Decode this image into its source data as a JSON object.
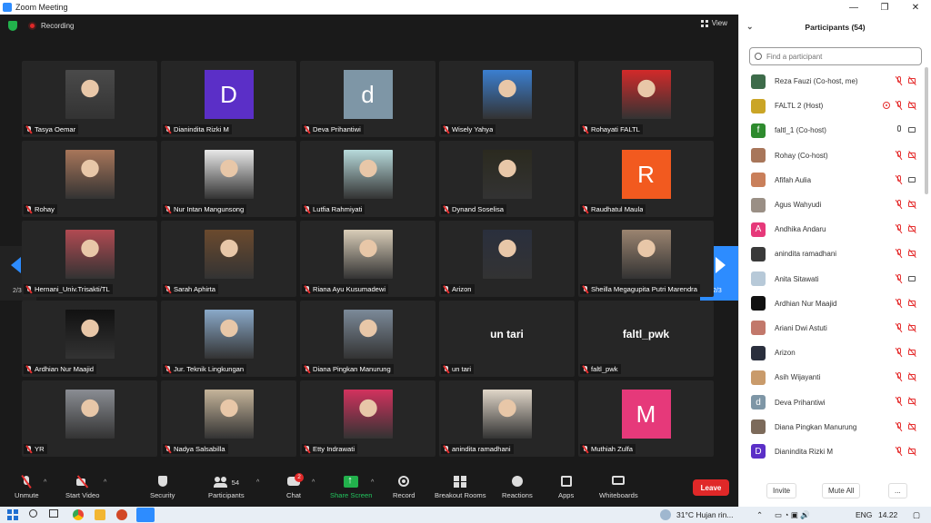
{
  "window": {
    "title": "Zoom Meeting",
    "minimize": "—",
    "maximize": "❐",
    "close": "✕"
  },
  "topbar": {
    "recording": "Recording",
    "view": "View"
  },
  "pager": {
    "left": "2/3",
    "right": "2/3"
  },
  "tiles": [
    {
      "name": "Tasya Oemar",
      "kind": "photo",
      "color": "#4a4a4a"
    },
    {
      "name": "Dianindita Rizki M",
      "kind": "letter",
      "letter": "D",
      "color": "#5b2fc7"
    },
    {
      "name": "Deva Prihantiwi",
      "kind": "letter",
      "letter": "d",
      "color": "#7e96a6"
    },
    {
      "name": "Wisely Yahya",
      "kind": "photo",
      "color": "#3b7fd0"
    },
    {
      "name": "Rohayati FALTL",
      "kind": "photo",
      "color": "#d22a2a"
    },
    {
      "name": "Rohay",
      "kind": "photo",
      "color": "#a8765a"
    },
    {
      "name": "Nur Intan Mangunsong",
      "kind": "photo",
      "color": "#e8e8e8"
    },
    {
      "name": "Lutfia Rahmiyati",
      "kind": "photo",
      "color": "#b7dadb"
    },
    {
      "name": "Dynand Soselisa",
      "kind": "photo",
      "color": "#2b2a1f"
    },
    {
      "name": "Raudhatul Maula",
      "kind": "letter",
      "letter": "R",
      "color": "#f25a1f"
    },
    {
      "name": "Hernani_Univ.Trisakti/TL",
      "kind": "photo",
      "color": "#b14a52"
    },
    {
      "name": "Sarah Aphirta",
      "kind": "photo",
      "color": "#6b4a2e"
    },
    {
      "name": "Riana Ayu Kusumadewi",
      "kind": "photo",
      "color": "#d9cdb8"
    },
    {
      "name": "Arizon",
      "kind": "photo",
      "color": "#2a2f3d"
    },
    {
      "name": "Sheilla Megagupita Putri Marendra",
      "kind": "photo",
      "color": "#9b8470"
    },
    {
      "name": "Ardhian Nur Maajid",
      "kind": "photo",
      "color": "#111111"
    },
    {
      "name": "Jur. Teknik Lingkungan",
      "kind": "photo",
      "color": "#8aa9c9"
    },
    {
      "name": "Diana Pingkan Manurung",
      "kind": "photo",
      "color": "#7c8a99"
    },
    {
      "name": "un tari",
      "kind": "text",
      "big": "un tari"
    },
    {
      "name": "faltl_pwk",
      "kind": "text",
      "big": "faltl_pwk"
    },
    {
      "name": "YR",
      "kind": "photo",
      "color": "#8a8d93"
    },
    {
      "name": "Nadya Salsabilla",
      "kind": "photo",
      "color": "#c5b49a"
    },
    {
      "name": "Etty Indrawati",
      "kind": "photo",
      "color": "#d2325e"
    },
    {
      "name": "anindita ramadhani",
      "kind": "photo",
      "color": "#e0d6c8"
    },
    {
      "name": "Muthiah Zulfa",
      "kind": "letter",
      "letter": "M",
      "color": "#e6397a"
    }
  ],
  "toolbar": {
    "unmute": "Unmute",
    "start_video": "Start Video",
    "security": "Security",
    "participants": "Participants",
    "participants_count": "54",
    "chat": "Chat",
    "chat_badge": "2",
    "share_screen": "Share Screen",
    "record": "Record",
    "breakout": "Breakout Rooms",
    "reactions": "Reactions",
    "apps": "Apps",
    "whiteboards": "Whiteboards",
    "leave": "Leave",
    "caret": "^"
  },
  "panel": {
    "title": "Participants (54)",
    "search_placeholder": "Find a participant",
    "invite": "Invite",
    "mute_all": "Mute All",
    "more": "..."
  },
  "participants": [
    {
      "name": "Reza Fauzi (Co-host, me)",
      "color": "#3d6b4a",
      "letter": "",
      "mic": "off",
      "cam": "off",
      "rec": false
    },
    {
      "name": "FALTL 2 (Host)",
      "color": "#caa526",
      "letter": "",
      "mic": "off",
      "cam": "off",
      "rec": true
    },
    {
      "name": "faltl_1 (Co-host)",
      "color": "#2e8b2e",
      "letter": "f",
      "mic": "on",
      "cam": "on",
      "rec": false
    },
    {
      "name": "Rohay (Co-host)",
      "color": "#a8765a",
      "letter": "",
      "mic": "off",
      "cam": "off",
      "rec": false
    },
    {
      "name": "Afifah Aulia",
      "color": "#c97f5a",
      "letter": "",
      "mic": "off",
      "cam": "on",
      "rec": false
    },
    {
      "name": "Agus Wahyudi",
      "color": "#9a8f85",
      "letter": "",
      "mic": "off",
      "cam": "off",
      "rec": false
    },
    {
      "name": "Andhika Andaru",
      "color": "#e6397a",
      "letter": "A",
      "mic": "off",
      "cam": "off",
      "rec": false
    },
    {
      "name": "anindita ramadhani",
      "color": "#3a3a3a",
      "letter": "",
      "mic": "off",
      "cam": "off",
      "rec": false
    },
    {
      "name": "Anita Sitawati",
      "color": "#b7c9d8",
      "letter": "",
      "mic": "off",
      "cam": "on",
      "rec": false
    },
    {
      "name": "Ardhian Nur Maajid",
      "color": "#111111",
      "letter": "",
      "mic": "off",
      "cam": "off",
      "rec": false
    },
    {
      "name": "Ariani Dwi Astuti",
      "color": "#c2786b",
      "letter": "",
      "mic": "off",
      "cam": "off",
      "rec": false
    },
    {
      "name": "Arizon",
      "color": "#2a2f3d",
      "letter": "",
      "mic": "off",
      "cam": "off",
      "rec": false
    },
    {
      "name": "Asih Wijayanti",
      "color": "#c99b6b",
      "letter": "",
      "mic": "off",
      "cam": "off",
      "rec": false
    },
    {
      "name": "Deva Prihantiwi",
      "color": "#7e96a6",
      "letter": "d",
      "mic": "off",
      "cam": "off",
      "rec": false
    },
    {
      "name": "Diana Pingkan Manurung",
      "color": "#7c6a5a",
      "letter": "",
      "mic": "off",
      "cam": "off",
      "rec": false
    },
    {
      "name": "Dianindita Rizki M",
      "color": "#5b2fc7",
      "letter": "D",
      "mic": "off",
      "cam": "off",
      "rec": false
    }
  ],
  "taskbar": {
    "weather": "31°C  Hujan rin...",
    "lang": "ENG",
    "time": "14.22"
  }
}
